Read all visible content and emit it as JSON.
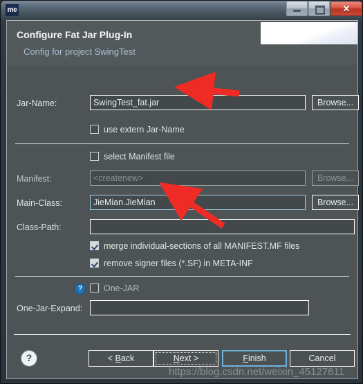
{
  "titlebar": {
    "icon_label": "me",
    "icon_name": "app-icon",
    "minimize_label": "",
    "maximize_label": "",
    "close_label": "✕"
  },
  "header": {
    "title": "Configure Fat Jar Plug-In",
    "subtitle": "Config for project SwingTest"
  },
  "form": {
    "jar_name_label": "Jar-Name:",
    "jar_name_value": "SwingTest_fat.jar",
    "jar_name_browse": "Browse...",
    "use_extern_label": "use extern Jar-Name",
    "select_manifest_label": "select Manifest file",
    "manifest_label": "Manifest:",
    "manifest_placeholder": "<createnew>",
    "manifest_browse": "Browse...",
    "main_class_label": "Main-Class:",
    "main_class_value": "JieMian.JieMian",
    "main_class_browse": "Browse...",
    "class_path_label": "Class-Path:",
    "class_path_value": "",
    "merge_sections_label": "merge individual-sections of all MANIFEST.MF files",
    "remove_signer_label": "remove signer files (*.SF) in META-INF",
    "one_jar_label": "One-JAR",
    "one_jar_help": "?",
    "one_jar_expand_label": "One-Jar-Expand:",
    "one_jar_expand_value": ""
  },
  "footer": {
    "help_label": "?",
    "back_label": "< Back",
    "back_mnemonic": "B",
    "next_label": "Next >",
    "next_mnemonic": "N",
    "finish_label": "Finish",
    "finish_mnemonic": "F",
    "cancel_label": "Cancel"
  },
  "watermark": {
    "text": "https://blog.csdn.net/weixin_45127611"
  },
  "colors": {
    "dialog_bg": "#4e5456",
    "header_bg": "#53595b",
    "field_bg": "#43494b",
    "border_white": "#ffffff",
    "subtitle": "#a9bfd1",
    "focus_blue": "#6fb2dc",
    "annotation_red": "#ee2b24",
    "help_blue": "#1f6fb5",
    "close_red": "#b83322"
  }
}
